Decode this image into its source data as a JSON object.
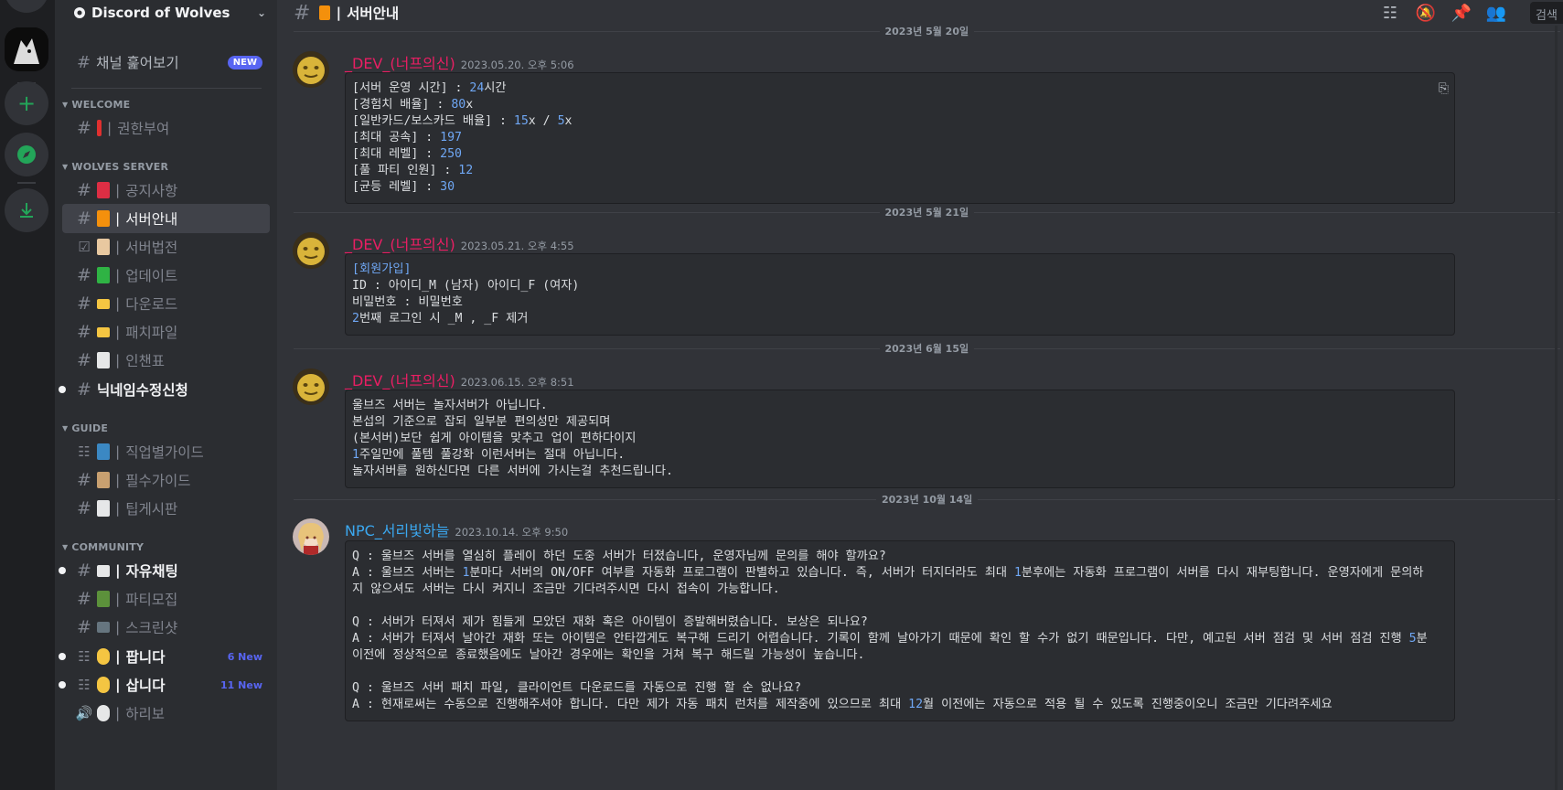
{
  "guild": {
    "name": "Discord of Wolves"
  },
  "sidebar": {
    "browse_label": "채널 훑어보기",
    "browse_badge": "NEW",
    "categories": [
      {
        "name": "WELCOME"
      },
      {
        "name": "WOLVES SERVER"
      },
      {
        "name": "GUIDE"
      },
      {
        "name": "COMMUNITY"
      }
    ],
    "channels": [
      {
        "label": "권한부여",
        "emoji_color": "#e0302f"
      },
      {
        "label": "공지사항",
        "emoji_color": "#dd2e44"
      },
      {
        "label": "서버안내",
        "emoji_color": "#f4900c"
      },
      {
        "label": "서버법전",
        "emoji_color": "#e8c8a0"
      },
      {
        "label": "업데이트",
        "emoji_color": "#2fb344"
      },
      {
        "label": "다운로드",
        "emoji_color": "#f4c542"
      },
      {
        "label": "패치파일",
        "emoji_color": "#f4c542"
      },
      {
        "label": "인챈표",
        "emoji_color": "#e6e7e8"
      },
      {
        "label": "닉네임수정신청",
        "emoji_color": ""
      },
      {
        "label": "직업별가이드",
        "emoji_color": "#3b88c3"
      },
      {
        "label": "필수가이드",
        "emoji_color": "#c8a070"
      },
      {
        "label": "팁게시판",
        "emoji_color": "#e6e7e8"
      },
      {
        "label": "자유채팅",
        "emoji_color": "#e6e7e8"
      },
      {
        "label": "파티모집",
        "emoji_color": "#5c913b"
      },
      {
        "label": "스크린샷",
        "emoji_color": "#66757f"
      },
      {
        "label": "팝니다",
        "emoji_color": "#f4c542",
        "badge": "6 New"
      },
      {
        "label": "삽니다",
        "emoji_color": "#f4c542",
        "badge": "11 New"
      },
      {
        "label": "하리보",
        "emoji_color": "#e6e7e8"
      }
    ]
  },
  "header": {
    "channel_name": "서버안내",
    "search_label": "검색",
    "icons": [
      "threads-icon",
      "mute-icon",
      "pin-icon",
      "members-icon"
    ]
  },
  "messages": [
    {
      "date_divider": "2023년 5월 20일",
      "author": "_DEV_(너프의신)",
      "author_color": "#e91e63",
      "timestamp": "2023.05.20. 오후 5:06",
      "lines": [
        [
          [
            "[서버 운영 시간] : ",
            ""
          ],
          [
            "24",
            "hl"
          ],
          [
            "시간",
            ""
          ]
        ],
        [
          [
            "[경험치 배율] : ",
            ""
          ],
          [
            "80",
            "hl"
          ],
          [
            "x",
            ""
          ]
        ],
        [
          [
            "[일반카드/보스카드 배율] : ",
            ""
          ],
          [
            "15",
            "hl"
          ],
          [
            "x / ",
            ""
          ],
          [
            "5",
            "hl"
          ],
          [
            "x",
            ""
          ]
        ],
        [
          [
            "[최대 공속] : ",
            ""
          ],
          [
            "197",
            "hl"
          ]
        ],
        [
          [
            "[최대 레벨] : ",
            ""
          ],
          [
            "250",
            "hl"
          ]
        ],
        [
          [
            "[풀 파티 인원] : ",
            ""
          ],
          [
            "12",
            "hl"
          ]
        ],
        [
          [
            "[균등 레벨] : ",
            ""
          ],
          [
            "30",
            "hl"
          ]
        ]
      ]
    },
    {
      "date_divider": "2023년 5월 21일",
      "author": "_DEV_(너프의신)",
      "author_color": "#e91e63",
      "timestamp": "2023.05.21. 오후 4:55",
      "lines": [
        [
          [
            "[회원가입]",
            "hl"
          ]
        ],
        [
          [
            "ID : 아이디_M (남자) 아이디_F (여자)",
            ""
          ]
        ],
        [
          [
            "비밀번호 : 비밀번호",
            ""
          ]
        ],
        [
          [
            "2",
            "hl"
          ],
          [
            "번째 로그인 시 _M , _F 제거",
            ""
          ]
        ]
      ]
    },
    {
      "date_divider": "2023년 6월 15일",
      "author": "_DEV_(너프의신)",
      "author_color": "#e91e63",
      "timestamp": "2023.06.15. 오후 8:51",
      "lines": [
        [
          [
            "울브즈 서버는 놀자서버가 아닙니다.",
            ""
          ]
        ],
        [
          [
            "본섭의 기준으로 잡되 일부분 편의성만 제공되며",
            ""
          ]
        ],
        [
          [
            "(본서버)보단 쉽게 아이템을 맞추고 업이 편하다이지",
            ""
          ]
        ],
        [
          [
            "1",
            "hl"
          ],
          [
            "주일만에 풀템 풀강화 이런서버는 절대 아닙니다.",
            ""
          ]
        ],
        [
          [
            "놀자서버를 원하신다면 다른 서버에 가시는걸 추천드립니다.",
            ""
          ]
        ]
      ]
    },
    {
      "date_divider": "2023년 10월 14일",
      "author": "NPC_서리빛하늘",
      "author_color": "#3ba8f0",
      "timestamp": "2023.10.14. 오후 9:50",
      "lines": [
        [
          [
            "Q : 울브즈 서버를 열심히 플레이 하던 도중 서버가 터졌습니다, 운영자님께 문의를 해야 할까요?",
            ""
          ]
        ],
        [
          [
            "A : 울브즈 서버는 ",
            ""
          ],
          [
            "1",
            "hl"
          ],
          [
            "분마다 서버의 ON/OFF 여부를 자동화 프로그램이 판별하고 있습니다. 즉, 서버가 터지더라도 최대 ",
            ""
          ],
          [
            "1",
            "hl"
          ],
          [
            "분후에는 자동화 프로그램이 서버를 다시 재부팅합니다. 운영자에게 문의하",
            ""
          ]
        ],
        [
          [
            "지 않으셔도 서버는 다시 켜지니 조금만 기다려주시면 다시 접속이 가능합니다.",
            ""
          ]
        ],
        [
          [
            "",
            ""
          ]
        ],
        [
          [
            "Q : 서버가 터져서 제가 힘들게 모았던 재화 혹은 아이템이 증발해버렸습니다. 보상은 되나요?",
            ""
          ]
        ],
        [
          [
            "A : 서버가 터져서 날아간 재화 또는 아이템은 안타깝게도 복구해 드리기 어렵습니다. 기록이 함께 날아가기 때문에 확인 할 수가 없기 때문입니다. 다만, 예고된 서버 점검 및 서버 점검 진행 ",
            ""
          ],
          [
            "5",
            "hl"
          ],
          [
            "분",
            ""
          ]
        ],
        [
          [
            "이전에 정상적으로 종료했음에도 날아간 경우에는 확인을 거쳐 복구 해드릴 가능성이 높습니다.",
            ""
          ]
        ],
        [
          [
            "",
            ""
          ]
        ],
        [
          [
            "Q : 울브즈 서버 패치 파일, 클라이언트 다운로드를 자동으로 진행 할 순 없나요?",
            ""
          ]
        ],
        [
          [
            "A : 현재로써는 수동으로 진행해주셔야 합니다. 다만 제가 자동 패치 런처를 제작중에 있으므로 최대 ",
            ""
          ],
          [
            "12",
            "hl"
          ],
          [
            "월 이전에는 자동으로 적용 될 수 있도록 진행중이오니 조금만 기다려주세요",
            ""
          ]
        ]
      ]
    }
  ]
}
